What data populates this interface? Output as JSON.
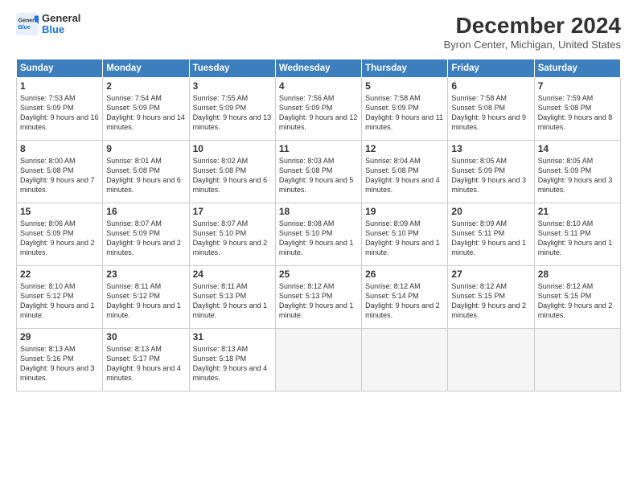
{
  "header": {
    "logo_line1": "General",
    "logo_line2": "Blue",
    "main_title": "December 2024",
    "subtitle": "Byron Center, Michigan, United States"
  },
  "days": [
    "Sunday",
    "Monday",
    "Tuesday",
    "Wednesday",
    "Thursday",
    "Friday",
    "Saturday"
  ],
  "weeks": [
    [
      {
        "num": "1",
        "sunrise": "Sunrise: 7:53 AM",
        "sunset": "Sunset: 5:09 PM",
        "daylight": "Daylight: 9 hours and 16 minutes."
      },
      {
        "num": "2",
        "sunrise": "Sunrise: 7:54 AM",
        "sunset": "Sunset: 5:09 PM",
        "daylight": "Daylight: 9 hours and 14 minutes."
      },
      {
        "num": "3",
        "sunrise": "Sunrise: 7:55 AM",
        "sunset": "Sunset: 5:09 PM",
        "daylight": "Daylight: 9 hours and 13 minutes."
      },
      {
        "num": "4",
        "sunrise": "Sunrise: 7:56 AM",
        "sunset": "Sunset: 5:09 PM",
        "daylight": "Daylight: 9 hours and 12 minutes."
      },
      {
        "num": "5",
        "sunrise": "Sunrise: 7:58 AM",
        "sunset": "Sunset: 5:09 PM",
        "daylight": "Daylight: 9 hours and 11 minutes."
      },
      {
        "num": "6",
        "sunrise": "Sunrise: 7:58 AM",
        "sunset": "Sunset: 5:08 PM",
        "daylight": "Daylight: 9 hours and 9 minutes."
      },
      {
        "num": "7",
        "sunrise": "Sunrise: 7:59 AM",
        "sunset": "Sunset: 5:08 PM",
        "daylight": "Daylight: 9 hours and 8 minutes."
      }
    ],
    [
      {
        "num": "8",
        "sunrise": "Sunrise: 8:00 AM",
        "sunset": "Sunset: 5:08 PM",
        "daylight": "Daylight: 9 hours and 7 minutes."
      },
      {
        "num": "9",
        "sunrise": "Sunrise: 8:01 AM",
        "sunset": "Sunset: 5:08 PM",
        "daylight": "Daylight: 9 hours and 6 minutes."
      },
      {
        "num": "10",
        "sunrise": "Sunrise: 8:02 AM",
        "sunset": "Sunset: 5:08 PM",
        "daylight": "Daylight: 9 hours and 6 minutes."
      },
      {
        "num": "11",
        "sunrise": "Sunrise: 8:03 AM",
        "sunset": "Sunset: 5:08 PM",
        "daylight": "Daylight: 9 hours and 5 minutes."
      },
      {
        "num": "12",
        "sunrise": "Sunrise: 8:04 AM",
        "sunset": "Sunset: 5:08 PM",
        "daylight": "Daylight: 9 hours and 4 minutes."
      },
      {
        "num": "13",
        "sunrise": "Sunrise: 8:05 AM",
        "sunset": "Sunset: 5:09 PM",
        "daylight": "Daylight: 9 hours and 3 minutes."
      },
      {
        "num": "14",
        "sunrise": "Sunrise: 8:05 AM",
        "sunset": "Sunset: 5:09 PM",
        "daylight": "Daylight: 9 hours and 3 minutes."
      }
    ],
    [
      {
        "num": "15",
        "sunrise": "Sunrise: 8:06 AM",
        "sunset": "Sunset: 5:09 PM",
        "daylight": "Daylight: 9 hours and 2 minutes."
      },
      {
        "num": "16",
        "sunrise": "Sunrise: 8:07 AM",
        "sunset": "Sunset: 5:09 PM",
        "daylight": "Daylight: 9 hours and 2 minutes."
      },
      {
        "num": "17",
        "sunrise": "Sunrise: 8:07 AM",
        "sunset": "Sunset: 5:10 PM",
        "daylight": "Daylight: 9 hours and 2 minutes."
      },
      {
        "num": "18",
        "sunrise": "Sunrise: 8:08 AM",
        "sunset": "Sunset: 5:10 PM",
        "daylight": "Daylight: 9 hours and 1 minute."
      },
      {
        "num": "19",
        "sunrise": "Sunrise: 8:09 AM",
        "sunset": "Sunset: 5:10 PM",
        "daylight": "Daylight: 9 hours and 1 minute."
      },
      {
        "num": "20",
        "sunrise": "Sunrise: 8:09 AM",
        "sunset": "Sunset: 5:11 PM",
        "daylight": "Daylight: 9 hours and 1 minute."
      },
      {
        "num": "21",
        "sunrise": "Sunrise: 8:10 AM",
        "sunset": "Sunset: 5:11 PM",
        "daylight": "Daylight: 9 hours and 1 minute."
      }
    ],
    [
      {
        "num": "22",
        "sunrise": "Sunrise: 8:10 AM",
        "sunset": "Sunset: 5:12 PM",
        "daylight": "Daylight: 9 hours and 1 minute."
      },
      {
        "num": "23",
        "sunrise": "Sunrise: 8:11 AM",
        "sunset": "Sunset: 5:12 PM",
        "daylight": "Daylight: 9 hours and 1 minute."
      },
      {
        "num": "24",
        "sunrise": "Sunrise: 8:11 AM",
        "sunset": "Sunset: 5:13 PM",
        "daylight": "Daylight: 9 hours and 1 minute."
      },
      {
        "num": "25",
        "sunrise": "Sunrise: 8:12 AM",
        "sunset": "Sunset: 5:13 PM",
        "daylight": "Daylight: 9 hours and 1 minute."
      },
      {
        "num": "26",
        "sunrise": "Sunrise: 8:12 AM",
        "sunset": "Sunset: 5:14 PM",
        "daylight": "Daylight: 9 hours and 2 minutes."
      },
      {
        "num": "27",
        "sunrise": "Sunrise: 8:12 AM",
        "sunset": "Sunset: 5:15 PM",
        "daylight": "Daylight: 9 hours and 2 minutes."
      },
      {
        "num": "28",
        "sunrise": "Sunrise: 8:12 AM",
        "sunset": "Sunset: 5:15 PM",
        "daylight": "Daylight: 9 hours and 2 minutes."
      }
    ],
    [
      {
        "num": "29",
        "sunrise": "Sunrise: 8:13 AM",
        "sunset": "Sunset: 5:16 PM",
        "daylight": "Daylight: 9 hours and 3 minutes."
      },
      {
        "num": "30",
        "sunrise": "Sunrise: 8:13 AM",
        "sunset": "Sunset: 5:17 PM",
        "daylight": "Daylight: 9 hours and 4 minutes."
      },
      {
        "num": "31",
        "sunrise": "Sunrise: 8:13 AM",
        "sunset": "Sunset: 5:18 PM",
        "daylight": "Daylight: 9 hours and 4 minutes."
      },
      null,
      null,
      null,
      null
    ]
  ]
}
